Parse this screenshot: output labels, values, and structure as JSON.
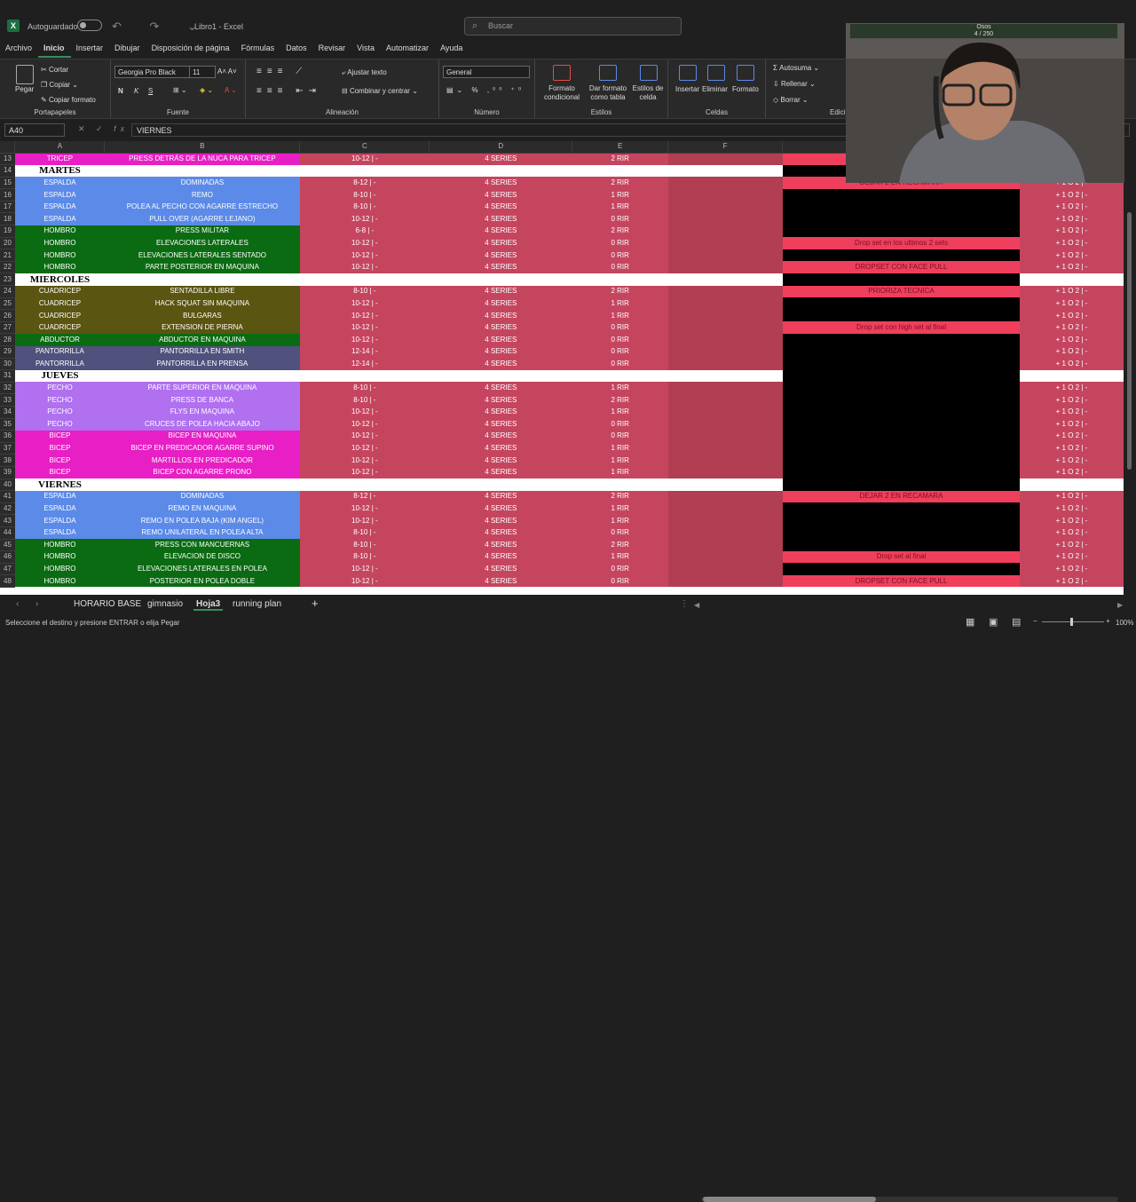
{
  "titlebar": {
    "app_icon": "X",
    "autosave": "Autoguardado",
    "document": "Libro1  -  Excel",
    "search_placeholder": "Buscar"
  },
  "menu": [
    "Archivo",
    "Inicio",
    "Insertar",
    "Dibujar",
    "Disposición de página",
    "Fórmulas",
    "Datos",
    "Revisar",
    "Vista",
    "Automatizar",
    "Ayuda"
  ],
  "ribbon": {
    "portapapeles": {
      "paste": "Pegar",
      "cut": "Cortar",
      "copy": "Copiar",
      "format_painter": "Copiar formato",
      "label": "Portapapeles"
    },
    "fuente": {
      "font": "Georgia Pro Black",
      "size": "11",
      "bold": "N",
      "italic": "K",
      "underline": "S",
      "label": "Fuente"
    },
    "alineacion": {
      "wrap": "Ajustar texto",
      "merge": "Combinar y centrar",
      "label": "Alineación"
    },
    "numero": {
      "format": "General",
      "label": "Número"
    },
    "estilos": {
      "cond": "Formato condicional",
      "table": "Dar formato como tabla",
      "cell": "Estilos de celda",
      "label": "Estilos"
    },
    "celdas": {
      "insert": "Insertar",
      "delete": "Eliminar",
      "format": "Formato",
      "label": "Celdas"
    },
    "edicion": {
      "autosum": "Autosuma",
      "fill": "Rellenar",
      "clear": "Borrar",
      "label": "Edici"
    }
  },
  "formula": {
    "namebox": "A40",
    "fx": "fx",
    "value": "VIERNES"
  },
  "columns": [
    "A",
    "B",
    "C",
    "D",
    "E",
    "F"
  ],
  "rows": [
    {
      "n": "13",
      "a": "TRICEP",
      "b": "PRESS DETRÁS DE LA NUCA PARA TRICEP",
      "c": "10-12 | -",
      "d": "4 SERIES",
      "e": "2 RIR",
      "g": "",
      "h": "",
      "col": "#e71fc4",
      "gh": true
    },
    {
      "n": "14",
      "day": "MARTES"
    },
    {
      "n": "15",
      "a": "ESPALDA",
      "b": "DOMINADAS",
      "c": "8-12 | -",
      "d": "4 SERIES",
      "e": "2 RIR",
      "g": "DEJAR 2 EN RECAMARA",
      "h": "+ 1 O 2 | -",
      "col": "#5b8ae8",
      "gh": true
    },
    {
      "n": "16",
      "a": "ESPALDA",
      "b": "REMO",
      "c": "8-10 | -",
      "d": "4 SERIES",
      "e": "1 RIR",
      "g": "",
      "h": "+ 1 O 2 | -",
      "col": "#5b8ae8"
    },
    {
      "n": "17",
      "a": "ESPALDA",
      "b": "POLEA AL PECHO CON AGARRE ESTRECHO",
      "c": "8-10 | -",
      "d": "4 SERIES",
      "e": "1 RIR",
      "g": "",
      "h": "+ 1 O 2 | -",
      "col": "#5b8ae8"
    },
    {
      "n": "18",
      "a": "ESPALDA",
      "b": "PULL OVER (AGARRE LEJANO)",
      "c": "10-12 | -",
      "d": "4 SERIES",
      "e": "0 RIR",
      "g": "",
      "h": "+ 1 O 2 | -",
      "col": "#5b8ae8"
    },
    {
      "n": "19",
      "a": "HOMBRO",
      "b": "PRESS MILITAR",
      "c": "6-8 | -",
      "d": "4 SERIES",
      "e": "2 RIR",
      "g": "",
      "h": "+ 1 O 2 | -",
      "col": "#0b6b12"
    },
    {
      "n": "20",
      "a": "HOMBRO",
      "b": "ELEVACIONES LATERALES",
      "c": "10-12 | -",
      "d": "4 SERIES",
      "e": "0 RIR",
      "g": "Drop set en los ultimos 2 sets",
      "h": "+ 1 O 2 | -",
      "col": "#0b6b12",
      "gh": true
    },
    {
      "n": "21",
      "a": "HOMBRO",
      "b": "ELEVACIONES LATERALES SENTADO",
      "c": "10-12 | -",
      "d": "4 SERIES",
      "e": "0 RIR",
      "g": "",
      "h": "+ 1 O 2 | -",
      "col": "#0b6b12"
    },
    {
      "n": "22",
      "a": "HOMBRO",
      "b": "PARTE POSTERIOR EN MAQUINA",
      "c": "10-12 | -",
      "d": "4 SERIES",
      "e": "0 RIR",
      "g": "DROPSET CON FACE PULL",
      "h": "+ 1 O 2 | -",
      "col": "#0b6b12",
      "gh": true
    },
    {
      "n": "23",
      "day": "MIERCOLES"
    },
    {
      "n": "24",
      "a": "CUADRICEP",
      "b": "SENTADILLA LIBRE",
      "c": "8-10 | -",
      "d": "4 SERIES",
      "e": "2 RIR",
      "g": "PRIORIZA TECNICA",
      "h": "+ 1 O 2 | -",
      "col": "#5a5510",
      "gh": true
    },
    {
      "n": "25",
      "a": "CUADRICEP",
      "b": "HACK SQUAT SIN MAQUINA",
      "c": "10-12 | -",
      "d": "4 SERIES",
      "e": "1 RIR",
      "g": "",
      "h": "+ 1 O 2 | -",
      "col": "#5a5510"
    },
    {
      "n": "26",
      "a": "CUADRICEP",
      "b": "BULGARAS",
      "c": "10-12 | -",
      "d": "4 SERIES",
      "e": "1 RIR",
      "g": "",
      "h": "+ 1 O 2 | -",
      "col": "#5a5510"
    },
    {
      "n": "27",
      "a": "CUADRICEP",
      "b": "EXTENSION DE PIERNA",
      "c": "10-12 | -",
      "d": "4 SERIES",
      "e": "0 RIR",
      "g": "Drop set con high set al final",
      "h": "+ 1 O 2 | -",
      "col": "#5a5510",
      "gh": true
    },
    {
      "n": "28",
      "a": "ABDUCTOR",
      "b": "ABDUCTOR EN MAQUINA",
      "c": "10-12 | -",
      "d": "4 SERIES",
      "e": "0 RIR",
      "g": "",
      "h": "+ 1 O 2 | -",
      "col": "#0b6b12"
    },
    {
      "n": "29",
      "a": "PANTORRILLA",
      "b": "PANTORRILLA EN SMITH",
      "c": "12-14 | -",
      "d": "4 SERIES",
      "e": "0 RIR",
      "g": "",
      "h": "+ 1 O 2 | -",
      "col": "#51517d"
    },
    {
      "n": "30",
      "a": "PANTORRILLA",
      "b": "PANTORRILLA EN PRENSA",
      "c": "12-14 | -",
      "d": "4 SERIES",
      "e": "0 RIR",
      "g": "",
      "h": "+ 1 O 2 | -",
      "col": "#51517d"
    },
    {
      "n": "31",
      "day": "JUEVES"
    },
    {
      "n": "32",
      "a": "PECHO",
      "b": "PARTE SUPERIOR EN MAQUINA",
      "c": "8-10 | -",
      "d": "4 SERIES",
      "e": "1 RIR",
      "g": "",
      "h": "+ 1 O 2 | -",
      "col": "#b070f0"
    },
    {
      "n": "33",
      "a": "PECHO",
      "b": "PRESS DE BANCA",
      "c": "8-10 | -",
      "d": "4 SERIES",
      "e": "2 RIR",
      "g": "",
      "h": "+ 1 O 2 | -",
      "col": "#b070f0"
    },
    {
      "n": "34",
      "a": "PECHO",
      "b": "FLYS EN MAQUINA",
      "c": "10-12 | -",
      "d": "4 SERIES",
      "e": "1 RIR",
      "g": "",
      "h": "+ 1 O 2 | -",
      "col": "#b070f0"
    },
    {
      "n": "35",
      "a": "PECHO",
      "b": "CRUCES DE POLEA HACIA ABAJO",
      "c": "10-12 | -",
      "d": "4 SERIES",
      "e": "0 RIR",
      "g": "",
      "h": "+ 1 O 2 | -",
      "col": "#b070f0"
    },
    {
      "n": "36",
      "a": "BICEP",
      "b": "BICEP EN MAQUINA",
      "c": "10-12 | -",
      "d": "4 SERIES",
      "e": "0 RIR",
      "g": "",
      "h": "+ 1 O 2 | -",
      "col": "#e71fc4"
    },
    {
      "n": "37",
      "a": "BICEP",
      "b": "BICEP EN PREDICADOR AGARRE SUPINO",
      "c": "10-12 | -",
      "d": "4 SERIES",
      "e": "1 RIR",
      "g": "",
      "h": "+ 1 O 2 | -",
      "col": "#e71fc4"
    },
    {
      "n": "38",
      "a": "BICEP",
      "b": "MARTILLOS EN PREDICADOR",
      "c": "10-12 | -",
      "d": "4 SERIES",
      "e": "1 RIR",
      "g": "",
      "h": "+ 1 O 2 | -",
      "col": "#e71fc4"
    },
    {
      "n": "39",
      "a": "BICEP",
      "b": "BICEP CON AGARRE PRONO",
      "c": "10-12 | -",
      "d": "4 SERIES",
      "e": "1 RIR",
      "g": "",
      "h": "+ 1 O 2 | -",
      "col": "#e71fc4"
    },
    {
      "n": "40",
      "day": "VIERNES"
    },
    {
      "n": "41",
      "a": "ESPALDA",
      "b": "DOMINADAS",
      "c": "8-12 | -",
      "d": "4 SERIES",
      "e": "2 RIR",
      "g": "DEJAR 2 EN RECAMARA",
      "h": "+ 1 O 2 | -",
      "col": "#5b8ae8",
      "gh": true
    },
    {
      "n": "42",
      "a": "ESPALDA",
      "b": "REMO EN MAQUINA",
      "c": "10-12 | -",
      "d": "4 SERIES",
      "e": "1 RIR",
      "g": "",
      "h": "+ 1 O 2 | -",
      "col": "#5b8ae8"
    },
    {
      "n": "43",
      "a": "ESPALDA",
      "b": "REMO EN POLEA BAJA (KIM ANGEL)",
      "c": "10-12 | -",
      "d": "4 SERIES",
      "e": "1 RIR",
      "g": "",
      "h": "+ 1 O 2 | -",
      "col": "#5b8ae8"
    },
    {
      "n": "44",
      "a": "ESPALDA",
      "b": "REMO UNILATERAL EN POLEA ALTA",
      "c": "8-10 | -",
      "d": "4 SERIES",
      "e": "0 RIR",
      "g": "",
      "h": "+ 1 O 2 | -",
      "col": "#5b8ae8"
    },
    {
      "n": "45",
      "a": "HOMBRO",
      "b": "PRESS CON MANCUERNAS",
      "c": "8-10 | -",
      "d": "4 SERIES",
      "e": "2 RIR",
      "g": "",
      "h": "+ 1 O 2 | -",
      "col": "#0b6b12"
    },
    {
      "n": "46",
      "a": "HOMBRO",
      "b": "ELEVACION DE DISCO",
      "c": "8-10 | -",
      "d": "4 SERIES",
      "e": "1 RIR",
      "g": "Drop set al final",
      "h": "+ 1 O 2 | -",
      "col": "#0b6b12",
      "gh": true
    },
    {
      "n": "47",
      "a": "HOMBRO",
      "b": "ELEVACIONES LATERALES EN POLEA",
      "c": "10-12 | -",
      "d": "4 SERIES",
      "e": "0 RIR",
      "g": "",
      "h": "+ 1 O 2 | -",
      "col": "#0b6b12"
    },
    {
      "n": "48",
      "a": "HOMBRO",
      "b": "POSTERIOR EN POLEA DOBLE",
      "c": "10-12 | -",
      "d": "4 SERIES",
      "e": "0 RIR",
      "g": "DROPSET CON FACE PULL",
      "h": "+ 1 O 2 | -",
      "col": "#0b6b12",
      "gh": true
    }
  ],
  "tabs": [
    "HORARIO BASE",
    "gimnasio",
    "Hoja3",
    "running plan"
  ],
  "status": {
    "message": "Seleccione el destino y presione ENTRAR o elija Pegar",
    "zoom": "100%"
  },
  "webcam": {
    "title": "Osos",
    "counter": "4 / 250"
  }
}
